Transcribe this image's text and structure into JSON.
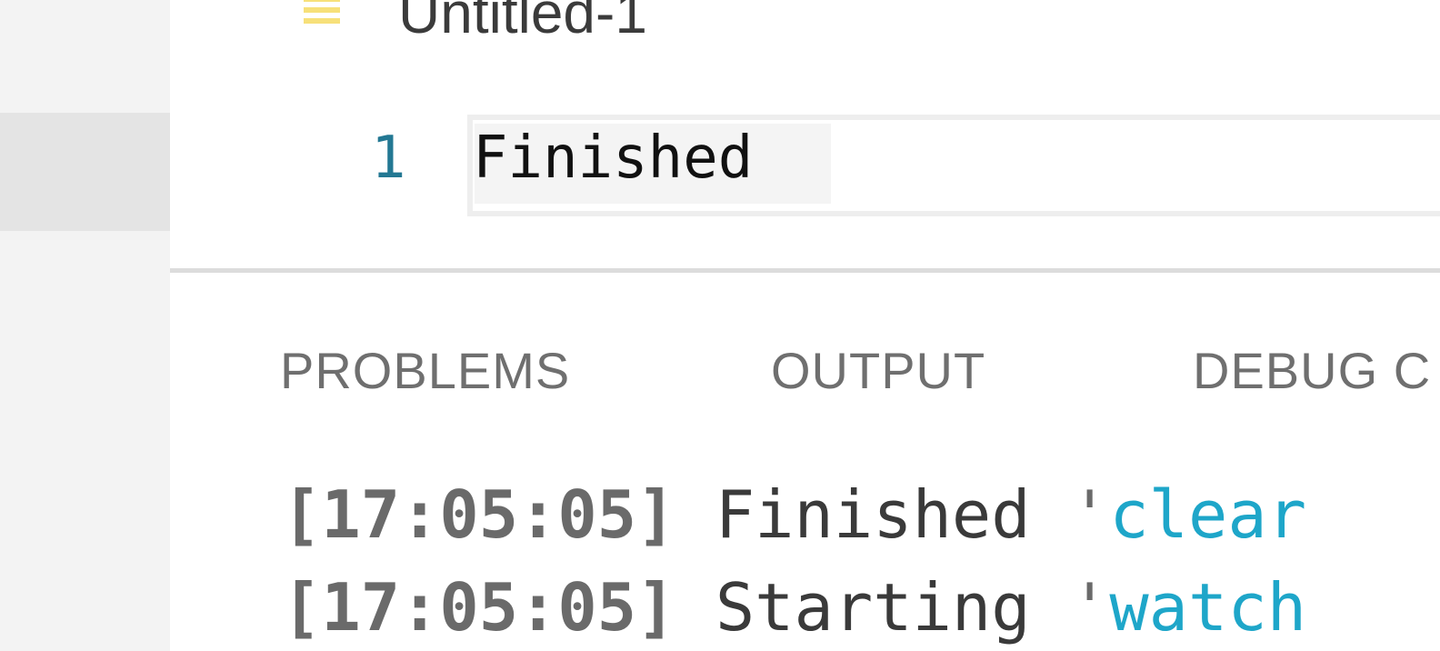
{
  "colors": {
    "sidebar_bg": "#f3f3f3",
    "line_number": "#237893",
    "task_name": "#1ea6c9",
    "file_icon": "#f7e07a"
  },
  "editor": {
    "tab_title": "Untitled-1",
    "file_icon_name": "text-file-icon",
    "line_number": "1",
    "line_text": "Finished"
  },
  "panel": {
    "tabs": [
      {
        "label": "PROBLEMS"
      },
      {
        "label": "OUTPUT"
      },
      {
        "label": "DEBUG C"
      }
    ],
    "output_lines": [
      {
        "timestamp": "[17:05:05]",
        "message": " Finished ",
        "quote": "'",
        "task": "clear"
      },
      {
        "timestamp": "[17:05:05]",
        "message": " Starting ",
        "quote": "'",
        "task": "watch"
      }
    ]
  }
}
